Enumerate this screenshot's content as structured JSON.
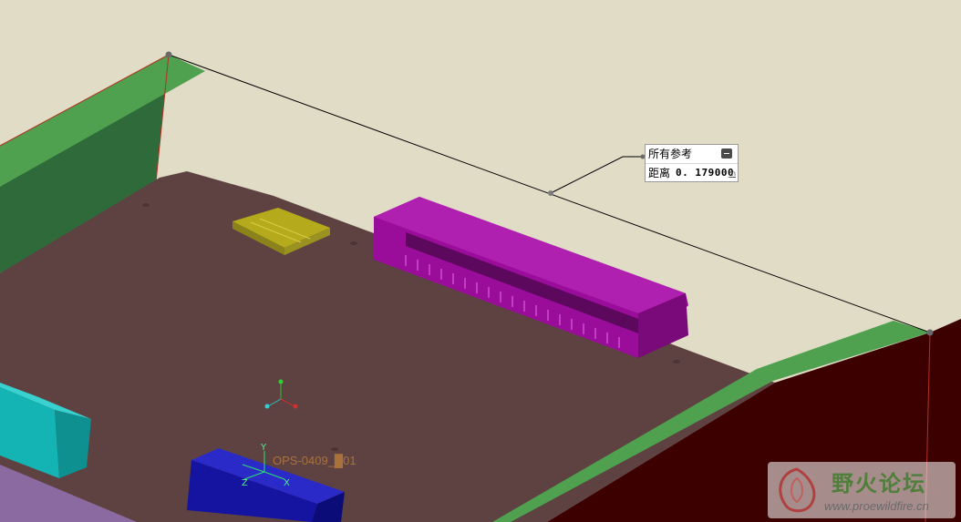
{
  "measurement": {
    "title": "所有参考",
    "distance_label": "距离",
    "distance_value": "0. 179000",
    "unit_mark": "m"
  },
  "part": {
    "label": "OPS-0409_█01"
  },
  "axes": {
    "x_label": "X",
    "y_label": "Y",
    "z_label": "Z"
  },
  "watermark": {
    "title": "野火论坛",
    "url": "www.proewildfire.cn"
  },
  "colors": {
    "background": "#e1dcc6",
    "board": "#5e4242",
    "enclosure_green": "#4fa04f",
    "enclosure_red": "#3c0000",
    "connector_magenta": "#9a0c9a",
    "sd_slot_yellow": "#b4aa1c",
    "cyan_block": "#14b4b4",
    "blue_block": "#1414a0"
  }
}
